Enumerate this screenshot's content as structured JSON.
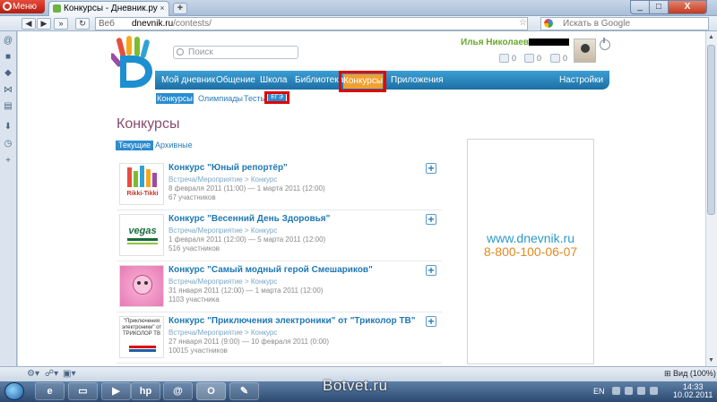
{
  "browser": {
    "menu_label": "Меню",
    "tab_title": "Конкурсы - Дневник.ру",
    "tab_close": "×",
    "new_tab": "+",
    "url_prefix": "Веб",
    "url_host": "dnevnik.ru",
    "url_path": "/contests/",
    "search_placeholder": "Искать в Google",
    "window_min": "_",
    "window_max": "□",
    "window_close": "X",
    "zoom_label": "Вид (100%)"
  },
  "site": {
    "search_placeholder": "Поиск",
    "user_name": "Илья Николаевич",
    "user_counters": [
      "0",
      "0",
      "0"
    ],
    "nav": [
      "Мой дневник",
      "Общение",
      "Школа",
      "Библиотека",
      "Конкурсы",
      "Приложения",
      "Настройки"
    ],
    "subnav": [
      "Конкурсы",
      "Олимпиады",
      "Тесты",
      "ЕГЭ"
    ],
    "page_title": "Конкурсы",
    "tabs": [
      "Текущие",
      "Архивные"
    ],
    "contests": [
      {
        "title": "Конкурс \"Юный репортёр\"",
        "category": "Встреча/Мероприятие > Конкурс",
        "dates": "8 февраля 2011 (11:00) — 1 марта 2011 (12:00)",
        "count": "67 участников",
        "thumb": "Rikki-Tikki"
      },
      {
        "title": "Конкурс \"Весенний День Здоровья\"",
        "category": "Встреча/Мероприятие > Конкурс",
        "dates": "1 февраля 2011 (12:00) — 5 марта 2011 (12:00)",
        "count": "516 участников",
        "thumb": "vegas"
      },
      {
        "title": "Конкурс \"Самый модный герой Смешариков\"",
        "category": "Встреча/Мероприятие > Конкурс",
        "dates": "31 января 2011 (12:00) — 1 марта 2011 (12:00)",
        "count": "1103 участника",
        "thumb": ""
      },
      {
        "title": "Конкурс \"Приключения электроники\" от \"Триколор ТВ\"",
        "category": "Встреча/Мероприятие > Конкурс",
        "dates": "27 января 2011 (9:00) — 10 февраля 2011 (0:00)",
        "count": "10015 участников",
        "thumb": "\"Приключения электроники\" от ТРИКОЛОР ТВ"
      }
    ],
    "ad": {
      "url": "www.dnevnik.ru",
      "phone": "8-800-100-06-07"
    }
  },
  "taskbar": {
    "watermark": "Botvet.ru",
    "lang": "EN",
    "time": "14:33",
    "date": "10.02.2011"
  },
  "colors": {
    "nav_blue": "#1c6fa5",
    "highlight_red": "#e00000",
    "active_orange": "#f0a030",
    "title_purple": "#8a4a6d"
  }
}
